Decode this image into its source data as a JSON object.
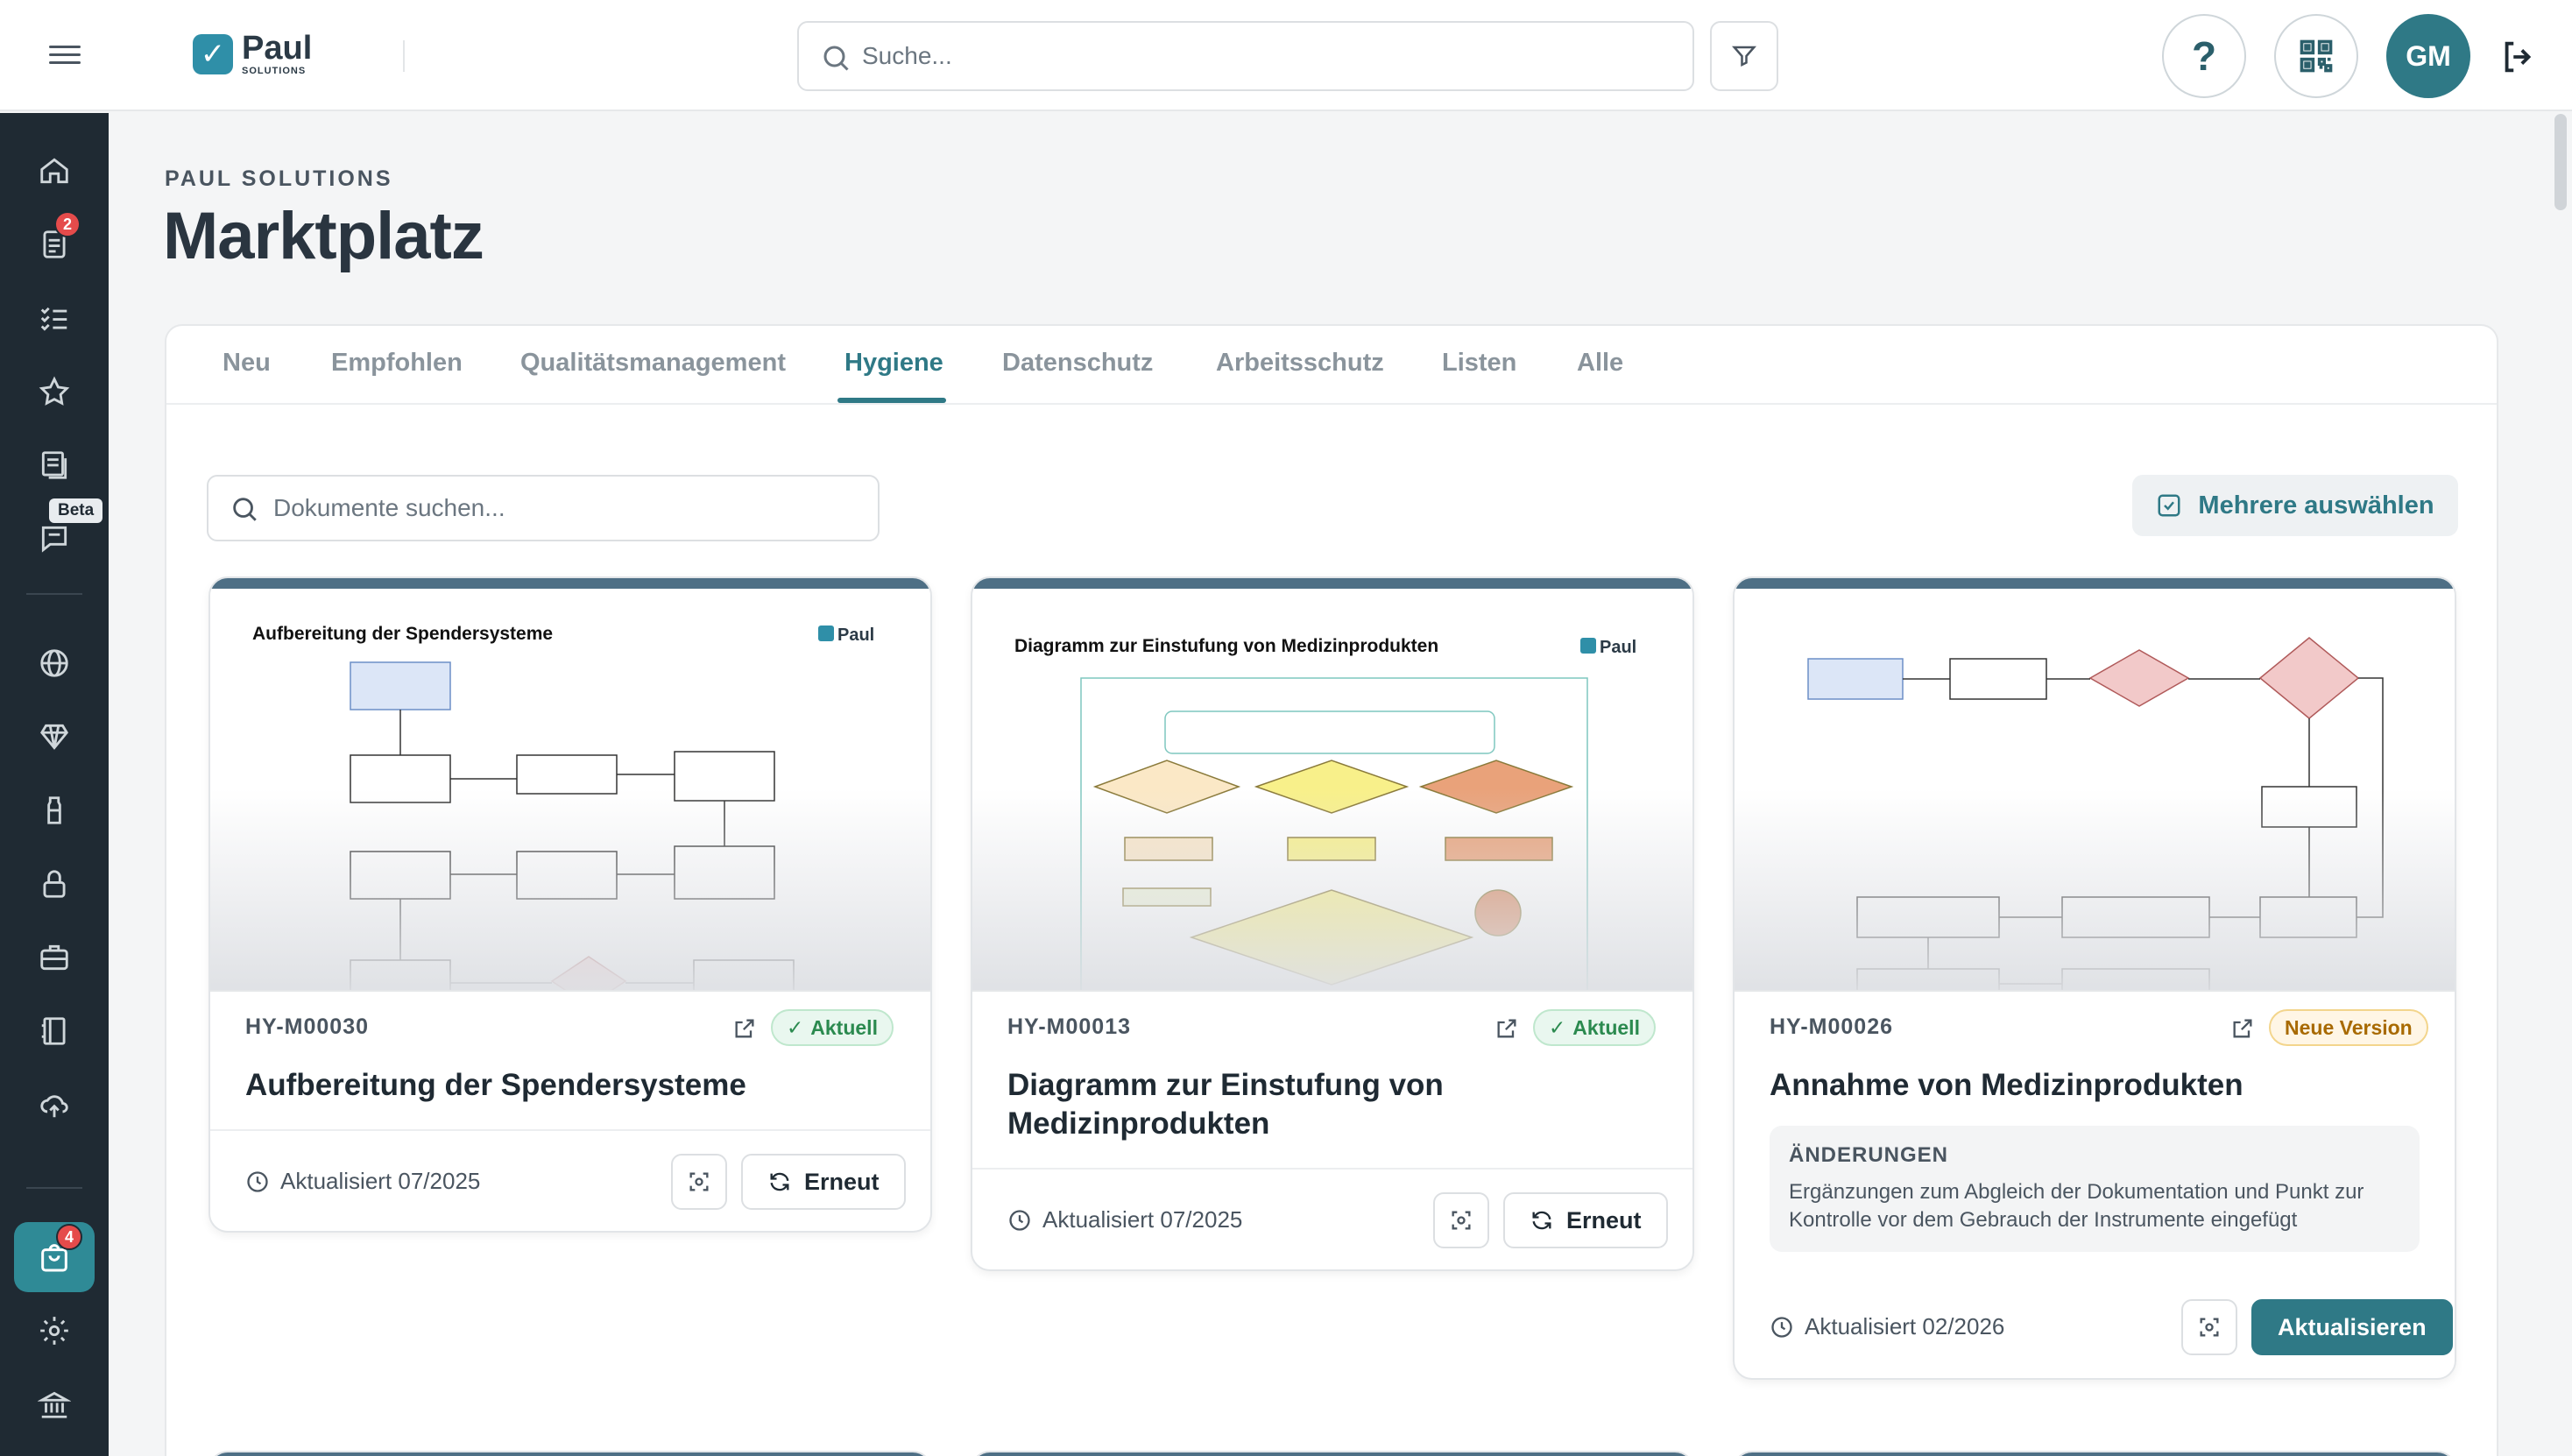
{
  "app": {
    "logo_text": "Paul",
    "logo_sub": "SOLUTIONS",
    "search_placeholder": "Suche...",
    "help_label": "?",
    "user_initials": "GM"
  },
  "sidebar": {
    "tasks_badge": "2",
    "beta_label": "Beta",
    "market_badge": "4"
  },
  "page": {
    "brand": "PAUL SOLUTIONS",
    "title": "Marktplatz"
  },
  "tabs": [
    "Neu",
    "Empfohlen",
    "Qualitätsmanagement",
    "Hygiene",
    "Datenschutz",
    "Arbeitsschutz",
    "Listen",
    "Alle"
  ],
  "active_tab": "Hygiene",
  "toolbar": {
    "doc_search_placeholder": "Dokumente suchen...",
    "multi_select_label": "Mehrere auswählen"
  },
  "cards": [
    {
      "code": "HY-M00030",
      "status": "Aktuell",
      "title": "Aufbereitung der Spendersysteme",
      "updated": "Aktualisiert 07/2025",
      "action": "Erneut",
      "thumb_title": "Aufbereitung der Spendersysteme",
      "thumb_logo": "Paul"
    },
    {
      "code": "HY-M00013",
      "status": "Aktuell",
      "title": "Diagramm zur Einstufung von Medizinprodukten",
      "updated": "Aktualisiert 07/2025",
      "action": "Erneut",
      "thumb_title": "Diagramm zur Einstufung von Medizinprodukten",
      "thumb_logo": "Paul"
    },
    {
      "code": "HY-M00026",
      "status": "Neue Version",
      "title": "Annahme von Medizinprodukten",
      "changes_label": "ÄNDERUNGEN",
      "changes_text": "Ergänzungen zum Abgleich der Dokumentation und Punkt zur Kontrolle vor dem Gebrauch der Instrumente eingefügt",
      "updated": "Aktualisiert 02/2026",
      "action": "Aktualisieren"
    }
  ],
  "colors": {
    "accent": "#2f7986",
    "sidebar": "#1f2a33",
    "badge_red": "#e54b4b",
    "card_stripe": "#4e6f85"
  }
}
